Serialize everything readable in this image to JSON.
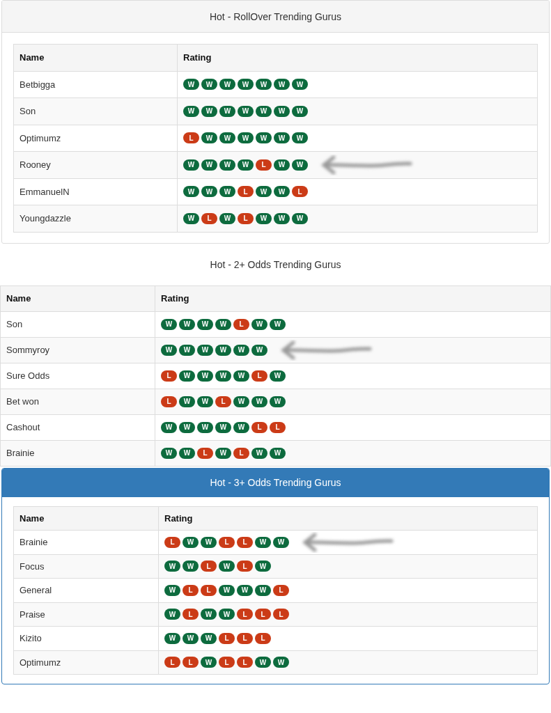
{
  "sections": [
    {
      "title": "Hot - RollOver Trending Gurus",
      "kind": "default",
      "columns": [
        "Name",
        "Rating"
      ],
      "rows": [
        {
          "name": "Betbigga",
          "arrow": false,
          "results": [
            {
              "text": "W",
              "kind": "win"
            },
            {
              "text": "W",
              "kind": "win"
            },
            {
              "text": "W",
              "kind": "win"
            },
            {
              "text": "W",
              "kind": "win"
            },
            {
              "text": "W",
              "kind": "win"
            },
            {
              "text": "W",
              "kind": "win"
            },
            {
              "text": "W",
              "kind": "win"
            }
          ]
        },
        {
          "name": "Son",
          "arrow": false,
          "results": [
            {
              "text": "W",
              "kind": "win"
            },
            {
              "text": "W",
              "kind": "win"
            },
            {
              "text": "W",
              "kind": "win"
            },
            {
              "text": "W",
              "kind": "win"
            },
            {
              "text": "W",
              "kind": "win"
            },
            {
              "text": "W",
              "kind": "win"
            },
            {
              "text": "W",
              "kind": "win"
            }
          ]
        },
        {
          "name": "Optimumz",
          "arrow": false,
          "results": [
            {
              "text": "L",
              "kind": "loss"
            },
            {
              "text": "W",
              "kind": "win"
            },
            {
              "text": "W",
              "kind": "win"
            },
            {
              "text": "W",
              "kind": "win"
            },
            {
              "text": "W",
              "kind": "win"
            },
            {
              "text": "W",
              "kind": "win"
            },
            {
              "text": "W",
              "kind": "win"
            }
          ]
        },
        {
          "name": "Rooney",
          "arrow": true,
          "results": [
            {
              "text": "W",
              "kind": "win"
            },
            {
              "text": "W",
              "kind": "win"
            },
            {
              "text": "W",
              "kind": "win"
            },
            {
              "text": "W",
              "kind": "win"
            },
            {
              "text": "L",
              "kind": "loss"
            },
            {
              "text": "W",
              "kind": "win"
            },
            {
              "text": "W",
              "kind": "win"
            }
          ]
        },
        {
          "name": "EmmanuelN",
          "arrow": false,
          "results": [
            {
              "text": "W",
              "kind": "win"
            },
            {
              "text": "W",
              "kind": "win"
            },
            {
              "text": "W",
              "kind": "win"
            },
            {
              "text": "L",
              "kind": "loss"
            },
            {
              "text": "W",
              "kind": "win"
            },
            {
              "text": "W",
              "kind": "win"
            },
            {
              "text": "L",
              "kind": "loss"
            }
          ]
        },
        {
          "name": "Youngdazzle",
          "arrow": false,
          "results": [
            {
              "text": "W",
              "kind": "win"
            },
            {
              "text": "L",
              "kind": "loss"
            },
            {
              "text": "W",
              "kind": "win"
            },
            {
              "text": "L",
              "kind": "loss"
            },
            {
              "text": "W",
              "kind": "win"
            },
            {
              "text": "W",
              "kind": "win"
            },
            {
              "text": "W",
              "kind": "win"
            }
          ]
        }
      ]
    },
    {
      "title": "Hot - 2+ Odds Trending Gurus",
      "kind": "plain",
      "columns": [
        "Name",
        "Rating"
      ],
      "rows": [
        {
          "name": "Son",
          "arrow": false,
          "results": [
            {
              "text": "W",
              "kind": "win"
            },
            {
              "text": "W",
              "kind": "win"
            },
            {
              "text": "W",
              "kind": "win"
            },
            {
              "text": "W",
              "kind": "win"
            },
            {
              "text": "L",
              "kind": "loss"
            },
            {
              "text": "W",
              "kind": "win"
            },
            {
              "text": "W",
              "kind": "win"
            }
          ]
        },
        {
          "name": "Sommyroy",
          "arrow": true,
          "results": [
            {
              "text": "W",
              "kind": "win"
            },
            {
              "text": "W",
              "kind": "win"
            },
            {
              "text": "W",
              "kind": "win"
            },
            {
              "text": "W",
              "kind": "win"
            },
            {
              "text": "W",
              "kind": "win"
            },
            {
              "text": "W",
              "kind": "win"
            }
          ]
        },
        {
          "name": "Sure Odds",
          "arrow": false,
          "results": [
            {
              "text": "L",
              "kind": "loss"
            },
            {
              "text": "W",
              "kind": "win"
            },
            {
              "text": "W",
              "kind": "win"
            },
            {
              "text": "W",
              "kind": "win"
            },
            {
              "text": "W",
              "kind": "win"
            },
            {
              "text": "L",
              "kind": "loss"
            },
            {
              "text": "W",
              "kind": "win"
            }
          ]
        },
        {
          "name": "Bet won",
          "arrow": false,
          "results": [
            {
              "text": "L",
              "kind": "loss"
            },
            {
              "text": "W",
              "kind": "win"
            },
            {
              "text": "W",
              "kind": "win"
            },
            {
              "text": "L",
              "kind": "loss"
            },
            {
              "text": "W",
              "kind": "win"
            },
            {
              "text": "W",
              "kind": "win"
            },
            {
              "text": "W",
              "kind": "win"
            }
          ]
        },
        {
          "name": "Cashout",
          "arrow": false,
          "results": [
            {
              "text": "W",
              "kind": "win"
            },
            {
              "text": "W",
              "kind": "win"
            },
            {
              "text": "W",
              "kind": "win"
            },
            {
              "text": "W",
              "kind": "win"
            },
            {
              "text": "W",
              "kind": "win"
            },
            {
              "text": "L",
              "kind": "loss"
            },
            {
              "text": "L",
              "kind": "loss"
            }
          ]
        },
        {
          "name": "Brainie",
          "arrow": false,
          "results": [
            {
              "text": "W",
              "kind": "win"
            },
            {
              "text": "W",
              "kind": "win"
            },
            {
              "text": "L",
              "kind": "loss"
            },
            {
              "text": "W",
              "kind": "win"
            },
            {
              "text": "L",
              "kind": "loss"
            },
            {
              "text": "W",
              "kind": "win"
            },
            {
              "text": "W",
              "kind": "win"
            }
          ]
        }
      ]
    },
    {
      "title": "Hot - 3+ Odds Trending Gurus",
      "kind": "primary",
      "columns": [
        "Name",
        "Rating"
      ],
      "rows": [
        {
          "name": "Brainie",
          "arrow": true,
          "results": [
            {
              "text": "L",
              "kind": "loss"
            },
            {
              "text": "W",
              "kind": "win"
            },
            {
              "text": "W",
              "kind": "win"
            },
            {
              "text": "L",
              "kind": "loss"
            },
            {
              "text": "L",
              "kind": "loss"
            },
            {
              "text": "W",
              "kind": "win"
            },
            {
              "text": "W",
              "kind": "win"
            }
          ]
        },
        {
          "name": "Focus",
          "arrow": false,
          "results": [
            {
              "text": "W",
              "kind": "win"
            },
            {
              "text": "W",
              "kind": "win"
            },
            {
              "text": "L",
              "kind": "loss"
            },
            {
              "text": "W",
              "kind": "win"
            },
            {
              "text": "L",
              "kind": "loss"
            },
            {
              "text": "W",
              "kind": "win"
            }
          ]
        },
        {
          "name": "General",
          "arrow": false,
          "results": [
            {
              "text": "W",
              "kind": "win"
            },
            {
              "text": "L",
              "kind": "loss"
            },
            {
              "text": "L",
              "kind": "loss"
            },
            {
              "text": "W",
              "kind": "win"
            },
            {
              "text": "W",
              "kind": "win"
            },
            {
              "text": "W",
              "kind": "win"
            },
            {
              "text": "L",
              "kind": "loss"
            }
          ]
        },
        {
          "name": "Praise",
          "arrow": false,
          "results": [
            {
              "text": "W",
              "kind": "win"
            },
            {
              "text": "L",
              "kind": "loss"
            },
            {
              "text": "W",
              "kind": "win"
            },
            {
              "text": "W",
              "kind": "win"
            },
            {
              "text": "L",
              "kind": "loss"
            },
            {
              "text": "L",
              "kind": "loss"
            },
            {
              "text": "L",
              "kind": "loss"
            }
          ]
        },
        {
          "name": "Kizito",
          "arrow": false,
          "results": [
            {
              "text": "W",
              "kind": "win"
            },
            {
              "text": "W",
              "kind": "win"
            },
            {
              "text": "W",
              "kind": "win"
            },
            {
              "text": "L",
              "kind": "loss"
            },
            {
              "text": "L",
              "kind": "loss"
            },
            {
              "text": "L",
              "kind": "loss"
            }
          ]
        },
        {
          "name": "Optimumz",
          "arrow": false,
          "results": [
            {
              "text": "L",
              "kind": "loss"
            },
            {
              "text": "L",
              "kind": "loss"
            },
            {
              "text": "W",
              "kind": "win"
            },
            {
              "text": "L",
              "kind": "loss"
            },
            {
              "text": "L",
              "kind": "loss"
            },
            {
              "text": "W",
              "kind": "win"
            },
            {
              "text": "W",
              "kind": "win"
            }
          ]
        }
      ]
    }
  ]
}
